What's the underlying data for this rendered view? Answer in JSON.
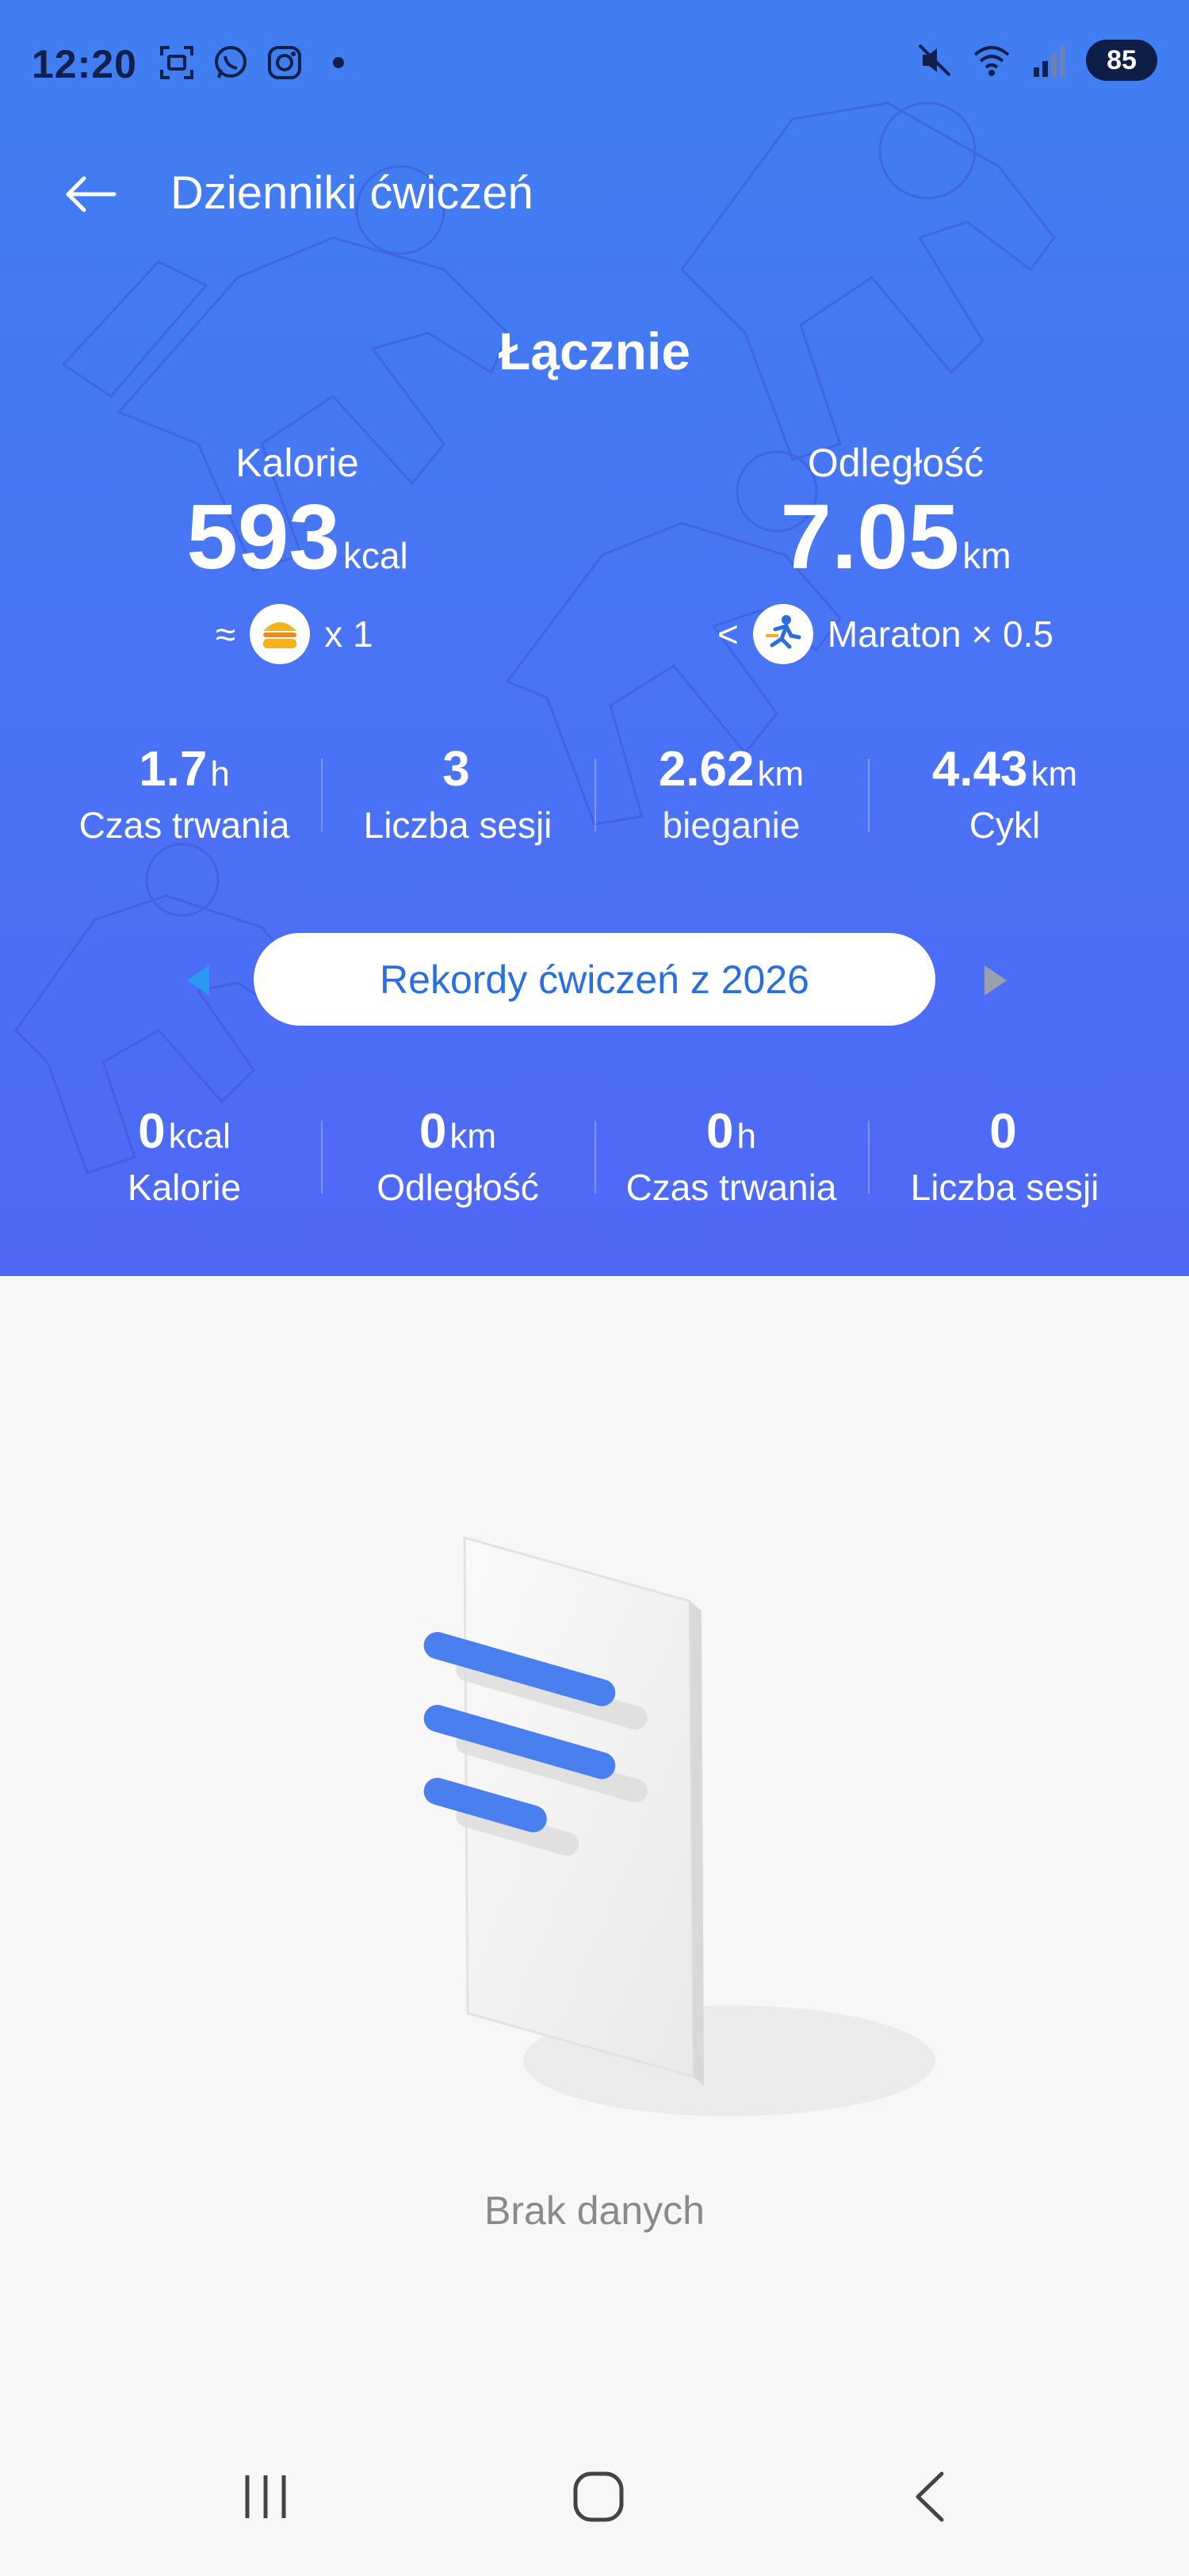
{
  "status_bar": {
    "time": "12:20",
    "battery": "85",
    "icons": [
      "screenshot-icon",
      "whatsapp-icon",
      "instagram-icon",
      "dot-icon",
      "mute-icon",
      "wifi-icon",
      "signal-icon"
    ]
  },
  "header": {
    "title": "Dzienniki ćwiczeń",
    "back_icon": "arrow-left-icon"
  },
  "summary": {
    "title": "Łącznie",
    "calories": {
      "label": "Kalorie",
      "value": "593",
      "unit": "kcal",
      "equiv_prefix": "≈",
      "equiv_icon": "burger-icon",
      "equiv_text": "x 1"
    },
    "distance": {
      "label": "Odległość",
      "value": "7.05",
      "unit": "km",
      "equiv_prefix": "<",
      "equiv_icon": "marathon-runner-icon",
      "equiv_text": "Maraton × 0.5"
    },
    "stats": [
      {
        "value": "1.7",
        "unit": "h",
        "label": "Czas trwania"
      },
      {
        "value": "3",
        "unit": "",
        "label": "Liczba sesji"
      },
      {
        "value": "2.62",
        "unit": "km",
        "label": "bieganie"
      },
      {
        "value": "4.43",
        "unit": "km",
        "label": "Cykl"
      }
    ]
  },
  "year_selector": {
    "label": "Rekordy ćwiczeń z 2026",
    "prev_icon": "triangle-left-icon",
    "next_icon": "triangle-right-icon"
  },
  "year_stats": [
    {
      "value": "0",
      "unit": "kcal",
      "label": "Kalorie"
    },
    {
      "value": "0",
      "unit": "km",
      "label": "Odległość"
    },
    {
      "value": "0",
      "unit": "h",
      "label": "Czas trwania"
    },
    {
      "value": "0",
      "unit": "",
      "label": "Liczba sesji"
    }
  ],
  "empty_state": {
    "text": "Brak danych",
    "icon": "empty-document-icon"
  },
  "colors": {
    "hero_top": "#3f7ff2",
    "hero_bottom": "#4f68f6",
    "accent": "#2a6fe0",
    "background": "#f7f7f7"
  }
}
